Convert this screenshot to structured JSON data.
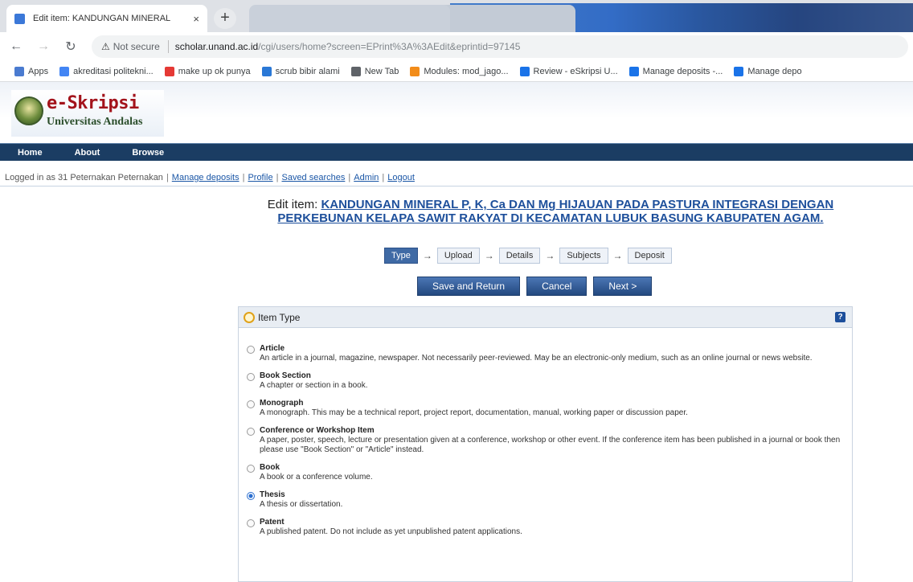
{
  "browser": {
    "active_tab_title": "Edit item: KANDUNGAN MINERAL",
    "tab_close": "×",
    "new_tab": "+",
    "url_warning": "Not secure",
    "url_host": "scholar.unand.ac.id",
    "url_path": "/cgi/users/home?screen=EPrint%3A%3AEdit&eprintid=97145",
    "bookmarks": [
      {
        "label": "Apps",
        "icon": "apps-grid-icon",
        "color": "#4a7bd0"
      },
      {
        "label": "akreditasi politekni...",
        "icon": "google-icon",
        "color": "#4285f4"
      },
      {
        "label": "make up ok punya",
        "icon": "youtube-icon",
        "color": "#e53935"
      },
      {
        "label": "scrub bibir alami",
        "icon": "bookmark-icon",
        "color": "#2a78d6"
      },
      {
        "label": "New Tab",
        "icon": "globe-icon",
        "color": "#5f6368"
      },
      {
        "label": "Modules: mod_jago...",
        "icon": "moodle-icon",
        "color": "#f28c1a"
      },
      {
        "label": "Review - eSkripsi U...",
        "icon": "page-icon",
        "color": "#1a73e8"
      },
      {
        "label": "Manage deposits -...",
        "icon": "page-icon",
        "color": "#1a73e8"
      },
      {
        "label": "Manage depo",
        "icon": "page-icon",
        "color": "#1a73e8"
      }
    ]
  },
  "site": {
    "logo_title": "e-Skripsi",
    "logo_subtitle": "Universitas Andalas",
    "nav": [
      "Home",
      "About",
      "Browse"
    ]
  },
  "login_bar": {
    "prefix": "Logged in as 31 Peternakan Peternakan",
    "links": [
      "Manage deposits",
      "Profile",
      "Saved searches",
      "Admin",
      "Logout"
    ]
  },
  "page": {
    "title_label": "Edit item: ",
    "title_link": "KANDUNGAN MINERAL P, K, Ca DAN Mg HIJAUAN PADA PASTURA INTEGRASI DENGAN PERKEBUNAN KELAPA SAWIT RAKYAT DI KECAMATAN LUBUK BASUNG KABUPATEN AGAM."
  },
  "workflow": {
    "steps": [
      "Type",
      "Upload",
      "Details",
      "Subjects",
      "Deposit"
    ],
    "current": "Type",
    "arrow": "→"
  },
  "actions": {
    "save_return": "Save and Return",
    "cancel": "Cancel",
    "next": "Next >"
  },
  "item_type": {
    "heading": "Item Type",
    "help": "?",
    "selected": "Thesis",
    "options": [
      {
        "name": "Article",
        "desc": "An article in a journal, magazine, newspaper. Not necessarily peer-reviewed. May be an electronic-only medium, such as an online journal or news website."
      },
      {
        "name": "Book Section",
        "desc": "A chapter or section in a book."
      },
      {
        "name": "Monograph",
        "desc": "A monograph. This may be a technical report, project report, documentation, manual, working paper or discussion paper."
      },
      {
        "name": "Conference or Workshop Item",
        "desc": "A paper, poster, speech, lecture or presentation given at a conference, workshop or other event. If the conference item has been published in a journal or book then please use \"Book Section\" or \"Article\" instead."
      },
      {
        "name": "Book",
        "desc": "A book or a conference volume."
      },
      {
        "name": "Thesis",
        "desc": "A thesis or dissertation."
      },
      {
        "name": "Patent",
        "desc": "A published patent. Do not include as yet unpublished patent applications."
      }
    ]
  }
}
